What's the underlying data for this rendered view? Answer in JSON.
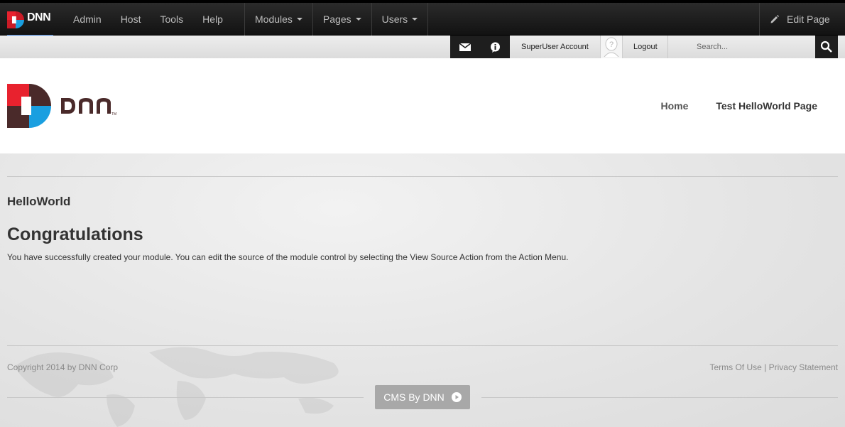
{
  "controlbar": {
    "logo_text": "DNN",
    "menu": [
      "Admin",
      "Host",
      "Tools",
      "Help"
    ],
    "dropdowns": [
      "Modules",
      "Pages",
      "Users"
    ],
    "edit_page": "Edit Page"
  },
  "userstrip": {
    "account": "SuperUser Account",
    "logout": "Logout",
    "search_placeholder": "Search..."
  },
  "header": {
    "logo_text": "DNN",
    "nav": [
      "Home",
      "Test HelloWorld Page"
    ]
  },
  "content": {
    "module_title": "HelloWorld",
    "heading": "Congratulations",
    "paragraph": "You have successfully created your module. You can edit the source of the module control by selecting the View Source Action from the Action Menu."
  },
  "footer": {
    "copyright": "Copyright 2014 by DNN Corp",
    "terms": "Terms Of Use",
    "separator": "|",
    "privacy": "Privacy Statement",
    "cms_button": "CMS By DNN"
  },
  "colors": {
    "dnn_red": "#e8222e",
    "dnn_blue": "#1a9fe0",
    "dnn_dark": "#4a2a2a",
    "accent_blue": "#3a7bd5"
  }
}
